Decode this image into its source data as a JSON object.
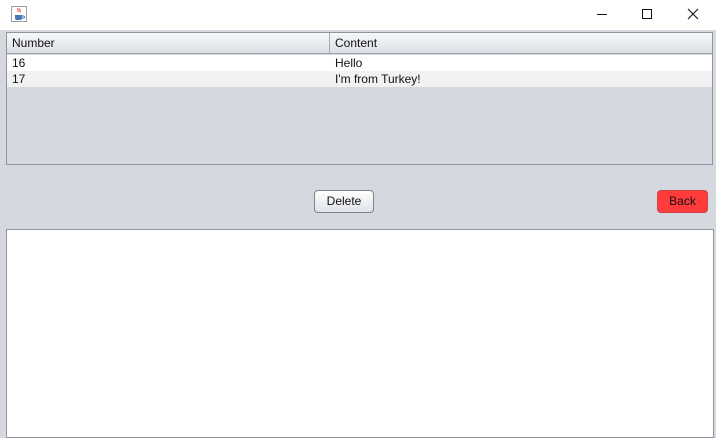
{
  "window": {
    "title": "",
    "icon": "java-cup-icon"
  },
  "window_controls": {
    "minimize_icon": "minimize-icon",
    "maximize_icon": "maximize-icon",
    "close_icon": "close-icon"
  },
  "table": {
    "columns": [
      "Number",
      "Content"
    ],
    "rows": [
      {
        "number": "16",
        "content": "Hello"
      },
      {
        "number": "17",
        "content": "I'm from Turkey!"
      }
    ]
  },
  "actions": {
    "delete_label": "Delete",
    "back_label": "Back",
    "back_color": "#ff3b3b"
  },
  "text_area": {
    "value": ""
  }
}
